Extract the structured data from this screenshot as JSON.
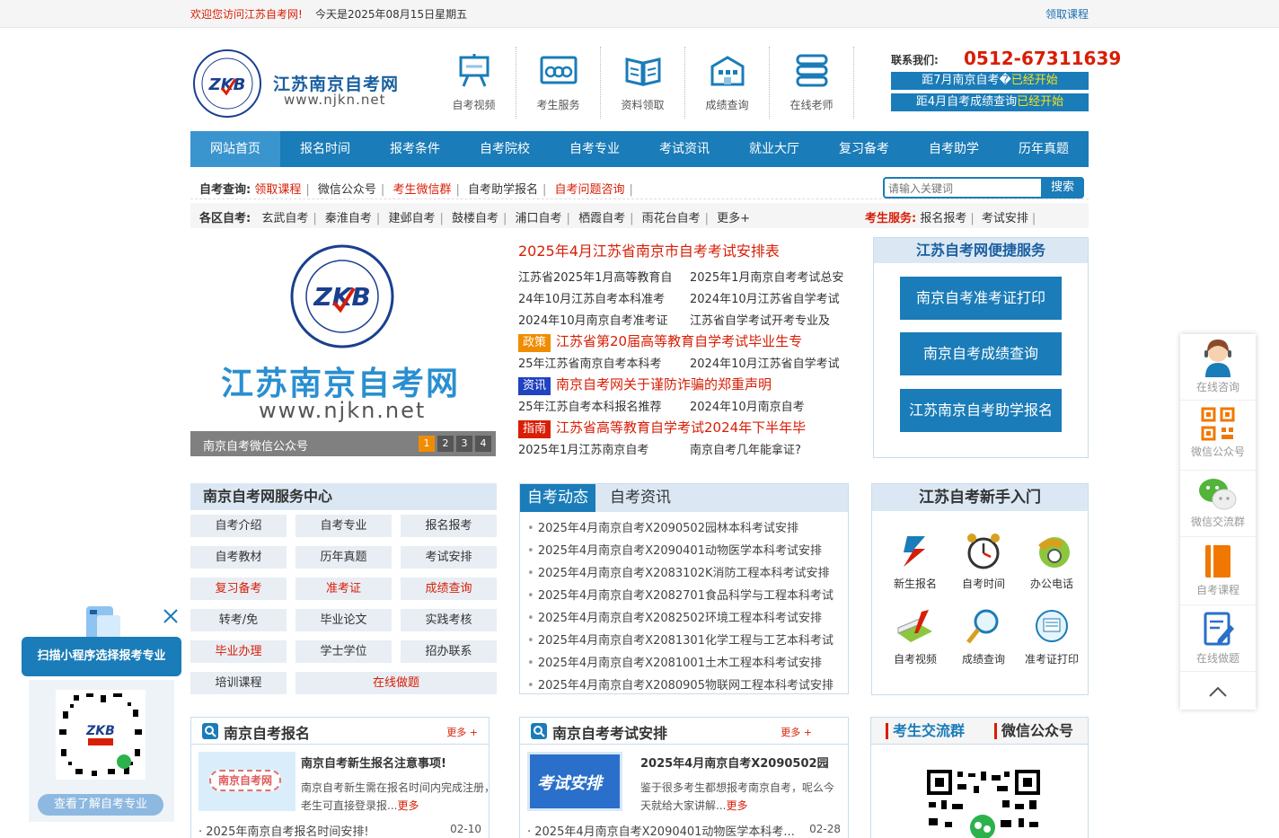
{
  "topbar": {
    "welcome": "欢迎您访问江苏自考网!",
    "date": "今天是2025年08月15日星期五",
    "get_course": "领取课程"
  },
  "header": {
    "site_name": "江苏南京自考网",
    "site_url": "www.njkn.net",
    "nav": [
      {
        "label": "自考视频",
        "icon": "presentation-board-icon"
      },
      {
        "label": "考生服务",
        "icon": "people-icon"
      },
      {
        "label": "资料领取",
        "icon": "open-book-icon"
      },
      {
        "label": "成绩查询",
        "icon": "building-icon"
      },
      {
        "label": "在线老师",
        "icon": "stack-icon"
      }
    ],
    "contact_label": "联系我们:",
    "phone": "0512-67311639",
    "notice1": {
      "text": "距7月南京自考�",
      "status": "已经开始"
    },
    "notice2": {
      "text": "距4月自考成绩查询",
      "status": "已经开始"
    }
  },
  "mainnav": [
    "网站首页",
    "报名时间",
    "报考条件",
    "自考院校",
    "自考专业",
    "考试资讯",
    "就业大厅",
    "复习备考",
    "自考助学",
    "历年真题"
  ],
  "query": {
    "label": "自考查询:",
    "links": [
      {
        "text": "领取课程",
        "red": true
      },
      {
        "text": "微信公众号",
        "red": false
      },
      {
        "text": "考生微信群",
        "red": true
      },
      {
        "text": "自考助学报名",
        "red": false
      },
      {
        "text": "自考问题咨询",
        "red": true
      }
    ]
  },
  "search": {
    "placeholder": "请输入关键词",
    "button": "搜索"
  },
  "region": {
    "label": "各区自考:",
    "links": [
      "玄武自考",
      "秦淮自考",
      "建邺自考",
      "鼓楼自考",
      "浦口自考",
      "栖霞自考",
      "雨花台自考",
      "更多+"
    ]
  },
  "service": {
    "label": "考生服务:",
    "links": [
      "报名报考",
      "考试安排"
    ]
  },
  "slider": {
    "logo_text": "ZKB",
    "title": "江苏南京自考网",
    "url": "www.njkn.net",
    "caption": "南京自考微信公众号",
    "dots": [
      "1",
      "2",
      "3",
      "4"
    ]
  },
  "headlines": {
    "main": "2025年4月江苏省南京市自考考试安排表",
    "rows": [
      [
        "江苏省2025年1月高等教育自",
        "2025年1月南京自考考试总安"
      ],
      [
        "24年10月江苏自考本科准考",
        "2024年10月江苏省自学考试"
      ],
      [
        "2024年10月南京自考准考证",
        "江苏省自学考试开考专业及"
      ]
    ],
    "tag1": {
      "tag": "政策",
      "title": "江苏省第20届高等教育自学考试毕业生专"
    },
    "tag1_rows": [
      "25年江苏省南京自考本科考",
      "2024年10月江苏省自学考试"
    ],
    "tag2": {
      "tag": "资讯",
      "title": "南京自考网关于谨防诈骗的郑重声明"
    },
    "tag2_rows": [
      "25年江苏自考本科报名推荐",
      "2024年10月南京自考"
    ],
    "tag3": {
      "tag": "指南",
      "title": "江苏省高等教育自学考试2024年下半年毕"
    },
    "tag3_rows": [
      "2025年1月江苏南京自考",
      "南京自考几年能拿证?"
    ]
  },
  "quick": {
    "title": "江苏自考网便捷服务",
    "buttons": [
      "南京自考准考证打印",
      "南京自考成绩查询",
      "江苏南京自考助学报名"
    ]
  },
  "service_center": {
    "title": "南京自考网服务中心",
    "items": [
      {
        "text": "自考介绍",
        "red": false
      },
      {
        "text": "自考专业",
        "red": false
      },
      {
        "text": "报名报考",
        "red": false
      },
      {
        "text": "自考教材",
        "red": false
      },
      {
        "text": "历年真题",
        "red": false
      },
      {
        "text": "考试安排",
        "red": false
      },
      {
        "text": "复习备考",
        "red": true
      },
      {
        "text": "准考证",
        "red": true
      },
      {
        "text": "成绩查询",
        "red": true
      },
      {
        "text": "转考/免",
        "red": false
      },
      {
        "text": "毕业论文",
        "red": false
      },
      {
        "text": "实践考核",
        "red": false
      },
      {
        "text": "毕业办理",
        "red": true
      },
      {
        "text": "学士学位",
        "red": false
      },
      {
        "text": "招办联系",
        "red": false
      },
      {
        "text": "培训课程",
        "red": false
      },
      {
        "text": "在线做题",
        "red": true
      }
    ]
  },
  "news": {
    "tab_active": "自考动态",
    "tab_other": "自考资讯",
    "items": [
      "2025年4月南京自考X2090502园林本科考试安排",
      "2025年4月南京自考X2090401动物医学本科考试安排",
      "2025年4月南京自考X2083102K消防工程本科考试安排",
      "2025年4月南京自考X2082701食品科学与工程本科考试",
      "2025年4月南京自考X2082502环境工程本科考试安排",
      "2025年4月南京自考X2081301化学工程与工艺本科考试",
      "2025年4月南京自考X2081001土木工程本科考试安排",
      "2025年4月南京自考X2080905物联网工程本科考试安排"
    ]
  },
  "newbie": {
    "title": "江苏自考新手入门",
    "items": [
      {
        "label": "新生报名",
        "icon": "register-icon"
      },
      {
        "label": "自考时间",
        "icon": "clock-icon"
      },
      {
        "label": "办公电话",
        "icon": "phone-icon"
      },
      {
        "label": "自考视频",
        "icon": "video-icon"
      },
      {
        "label": "成绩查询",
        "icon": "magnifier-icon"
      },
      {
        "label": "准考证打印",
        "icon": "print-icon"
      }
    ]
  },
  "box_signup": {
    "title": "南京自考报名",
    "more": "更多 +",
    "thumb_text": "南京自考网",
    "headline": "南京自考新生报名注意事项!",
    "desc": "南京自考新生需在报名时间内完成注册，老生可直接登录报...",
    "more_link": "更多",
    "foot": "2025年南京自考报名时间安排!",
    "date": "02-10"
  },
  "box_exam": {
    "title": "南京自考考试安排",
    "more": "更多 +",
    "thumb_text": "考试安排",
    "headline": "2025年4月南京自考X2090502园",
    "desc": "鉴于很多考生都想报考南京自考，呢么今天就给大家讲解...",
    "more_link": "更多",
    "foot": "2025年4月南京自考X2090401动物医学本科考...",
    "date": "02-28"
  },
  "box_group": {
    "tab1": "考生交流群",
    "tab2": "微信公众号"
  },
  "floatbar": [
    "在线咨询",
    "微信公众号",
    "微信交流群",
    "自考课程",
    "在线做题"
  ],
  "popup": {
    "title": "扫描小程序选择报考专业",
    "badge": "ZKB",
    "button": "查看了解自考专业"
  },
  "colors": {
    "primary": "#1a7cb8",
    "red": "#d81e06",
    "light": "#dbe8f4"
  }
}
